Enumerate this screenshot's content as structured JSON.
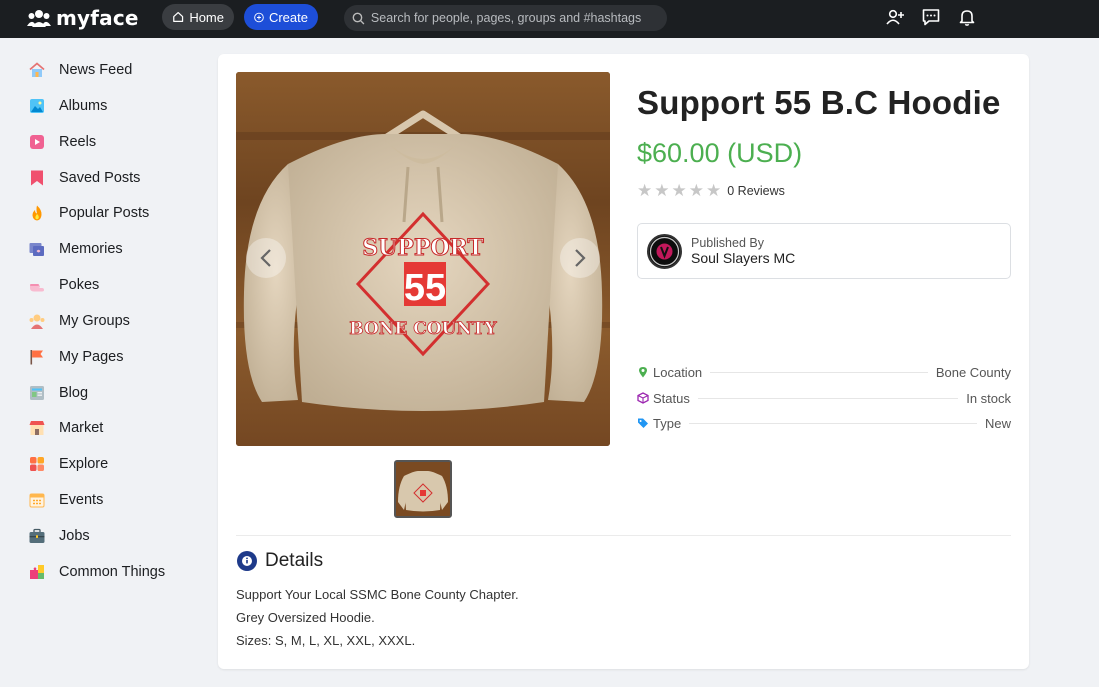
{
  "app": {
    "logo_text": "myface",
    "home_label": "Home",
    "create_label": "Create",
    "search_placeholder": "Search for people, pages, groups and #hashtags"
  },
  "top_icons": [
    "add-friend-icon",
    "messages-icon",
    "notifications-icon"
  ],
  "sidebar": {
    "items": [
      {
        "label": "News Feed",
        "icon": "house-icon"
      },
      {
        "label": "Albums",
        "icon": "albums-icon"
      },
      {
        "label": "Reels",
        "icon": "reels-icon"
      },
      {
        "label": "Saved Posts",
        "icon": "bookmark-icon"
      },
      {
        "label": "Popular Posts",
        "icon": "fire-icon"
      },
      {
        "label": "Memories",
        "icon": "memories-icon"
      },
      {
        "label": "Pokes",
        "icon": "poke-icon"
      },
      {
        "label": "My Groups",
        "icon": "groups-icon"
      },
      {
        "label": "My Pages",
        "icon": "flag-icon"
      },
      {
        "label": "Blog",
        "icon": "blog-icon"
      },
      {
        "label": "Market",
        "icon": "market-icon"
      },
      {
        "label": "Explore",
        "icon": "explore-icon"
      },
      {
        "label": "Events",
        "icon": "calendar-icon"
      },
      {
        "label": "Jobs",
        "icon": "briefcase-icon"
      },
      {
        "label": "Common Things",
        "icon": "puzzle-icon"
      }
    ]
  },
  "product": {
    "title": "Support 55 B.C Hoodie",
    "price": "$60.00 (USD)",
    "rating": 0,
    "rating_max": 5,
    "reviews_label": "0 Reviews",
    "image_logo_text": {
      "top": "SUPPORT",
      "number": "55",
      "bottom": "BONE COUNTY"
    },
    "publisher": {
      "caption": "Published By",
      "name": "Soul Slayers MC"
    },
    "info": {
      "location_label": "Location",
      "location_value": "Bone County",
      "status_label": "Status",
      "status_value": "In stock",
      "type_label": "Type",
      "type_value": "New"
    },
    "details": {
      "heading": "Details",
      "lines": [
        "Support Your Local SSMC Bone County Chapter.",
        "Grey Oversized Hoodie.",
        "Sizes: S, M, L, XL, XXL, XXXL."
      ]
    }
  },
  "colors": {
    "topbar": "#1b1e21",
    "create_button": "#1d4ed8",
    "price": "#4caf50",
    "details_icon": "#1e3a8a"
  }
}
